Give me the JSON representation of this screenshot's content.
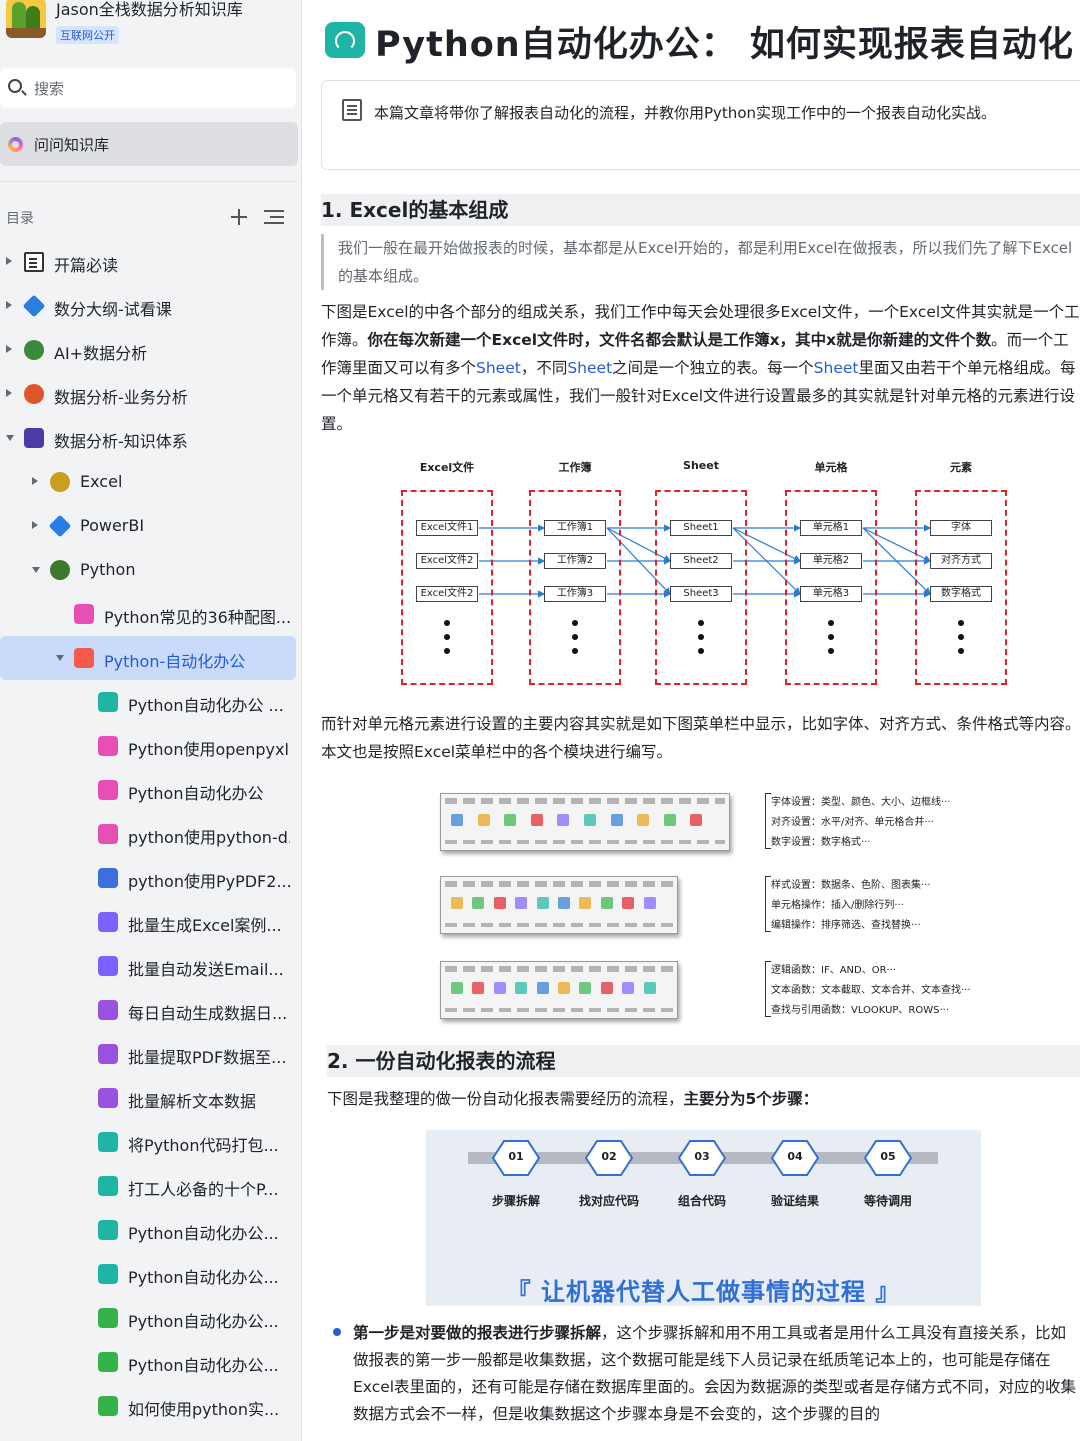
{
  "sidebar": {
    "kb_title": "Jason全栈数据分析知识库",
    "kb_badge": "互联网公开",
    "search_label": "搜索",
    "ask_label": "问问知识库",
    "toc_label": "目录",
    "items": [
      {
        "label": "开篇必读",
        "level": 0,
        "caret": "right",
        "icon": "notepad-icon",
        "color": "#333333"
      },
      {
        "label": "数分大纲-试看课",
        "level": 0,
        "caret": "right",
        "icon": "diamond-icon",
        "color": "#2a7de1"
      },
      {
        "label": "AI+数据分析",
        "level": 0,
        "caret": "right",
        "icon": "ufo-icon",
        "color": "#3a8a3a"
      },
      {
        "label": "数据分析-业务分析",
        "level": 0,
        "caret": "right",
        "icon": "medal-icon",
        "color": "#e0562b"
      },
      {
        "label": "数据分析-知识体系",
        "level": 0,
        "caret": "down",
        "icon": "music-icon",
        "color": "#4b3ba8"
      },
      {
        "label": "Excel",
        "level": 1,
        "caret": "right",
        "icon": "leaf-icon",
        "color": "#c8a01e"
      },
      {
        "label": "PowerBI",
        "level": 1,
        "caret": "right",
        "icon": "diamond-icon",
        "color": "#2a7de1"
      },
      {
        "label": "Python",
        "level": 1,
        "caret": "down",
        "icon": "snake-icon",
        "color": "#3b7a2a"
      },
      {
        "label": "Python常见的36种配图...",
        "level": 2,
        "caret": "",
        "icon": "board-icon",
        "color": "#e84fb4"
      },
      {
        "label": "Python-自动化办公",
        "level": 2,
        "caret": "down",
        "icon": "board-icon",
        "color": "#f25a4c"
      },
      {
        "label": "Python自动化办公 ...",
        "level": 3,
        "caret": "",
        "icon": "board-icon",
        "color": "#1fb5a5"
      },
      {
        "label": "Python使用openpyxl...",
        "level": 3,
        "caret": "",
        "icon": "board-icon",
        "color": "#e84fb4"
      },
      {
        "label": "Python自动化办公",
        "level": 3,
        "caret": "",
        "icon": "board-icon",
        "color": "#e84fb4"
      },
      {
        "label": "python使用python-d...",
        "level": 3,
        "caret": "",
        "icon": "board-icon",
        "color": "#e84fb4"
      },
      {
        "label": "python使用PyPDF2...",
        "level": 3,
        "caret": "",
        "icon": "board-icon",
        "color": "#3b6fe0"
      },
      {
        "label": "批量生成Excel案例...",
        "level": 3,
        "caret": "",
        "icon": "board-icon",
        "color": "#7b61ff"
      },
      {
        "label": "批量自动发送Email...",
        "level": 3,
        "caret": "",
        "icon": "board-icon",
        "color": "#7b61ff"
      },
      {
        "label": "每日自动生成数据日...",
        "level": 3,
        "caret": "",
        "icon": "board-icon",
        "color": "#9b51e0"
      },
      {
        "label": "批量提取PDF数据至...",
        "level": 3,
        "caret": "",
        "icon": "board-icon",
        "color": "#9b51e0"
      },
      {
        "label": "批量解析文本数据",
        "level": 3,
        "caret": "",
        "icon": "board-icon",
        "color": "#9b51e0"
      },
      {
        "label": "将Python代码打包...",
        "level": 3,
        "caret": "",
        "icon": "board-icon",
        "color": "#1fb5a5"
      },
      {
        "label": "打工人必备的十个P...",
        "level": 3,
        "caret": "",
        "icon": "board-icon",
        "color": "#1fb5a5"
      },
      {
        "label": "Python自动化办公...",
        "level": 3,
        "caret": "",
        "icon": "board-icon",
        "color": "#1fb5a5"
      },
      {
        "label": "Python自动化办公...",
        "level": 3,
        "caret": "",
        "icon": "board-icon",
        "color": "#1fb5a5"
      },
      {
        "label": "Python自动化办公...",
        "level": 3,
        "caret": "",
        "icon": "board-icon",
        "color": "#35b34a"
      },
      {
        "label": "Python自动化办公...",
        "level": 3,
        "caret": "",
        "icon": "board-icon",
        "color": "#35b34a"
      },
      {
        "label": "如何使用python实...",
        "level": 3,
        "caret": "",
        "icon": "board-icon",
        "color": "#35b34a"
      }
    ],
    "active_index": 9
  },
  "doc": {
    "title": "Python自动化办公： 如何实现报表自动化",
    "callout": "本篇文章将带你了解报表自动化的流程，并教你用Python实现工作中的一个报表自动化实战。",
    "h1": "1. Excel的基本组成",
    "quote": "我们一般在最开始做报表的时候，基本都是从Excel开始的，都是利用Excel在做报表，所以我们先了解下Excel的基本组成。",
    "para1_a": "下图是Excel的中各个部分的组成关系，我们工作中每天会处理很多Excel文件，一个Excel文件其实就是一个工作簿。",
    "para1_b": "你在每次新建一个Excel文件时，文件名都会默认是工作簿x，其中x就是你新建的文件个数",
    "para1_c": "。而一个工作簿里面又可以有多个",
    "para1_link": "Sheet",
    "para1_d": "，不同",
    "para1_e": "之间是一个独立的表。每一个",
    "para1_f": "里面又由若干个单元格组成。每一个单元格又有若干的元素或属性，我们一般针对Excel文件进行设置最多的其实就是针对单元格的元素进行设置。",
    "para2": "而针对单元格元素进行设置的主要内容其实就是如下图菜单栏中显示，比如字体、对齐方式、条件格式等内容。本文也是按照Excel菜单栏中的各个模块进行编写。",
    "h2": "2. 一份自动化报表的流程",
    "para3_a": "下图是我整理的做一份自动化报表需要经历的流程，",
    "para3_b": "主要分为5个步骤：",
    "bullet_b": "第一步是对要做的报表进行步骤拆解",
    "bullet_rest": "，这个步骤拆解和用不用工具或者是用什么工具没有直接关系，比如做报表的第一步一般都是收集数据，这个数据可能是线下人员记录在纸质笔记本上的，也可能是存储在Excel表里面的，还有可能是存储在数据库里面的。会因为数据源的类型或者是存储方式不同，对应的收集数据方式会不一样，但是收集数据这个步骤本身是不会变的，这个步骤的目的"
  },
  "diagram": {
    "columns": [
      {
        "header": "Excel文件",
        "cells": [
          "Excel文件1",
          "Excel文件2",
          "Excel文件2"
        ]
      },
      {
        "header": "工作簿",
        "cells": [
          "工作簿1",
          "工作簿2",
          "工作簿3"
        ]
      },
      {
        "header": "Sheet",
        "cells": [
          "Sheet1",
          "Sheet2",
          "Sheet3"
        ]
      },
      {
        "header": "单元格",
        "cells": [
          "单元格1",
          "单元格2",
          "单元格3"
        ]
      },
      {
        "header": "元素",
        "cells": [
          "字体",
          "对齐方式",
          "数字格式"
        ]
      }
    ],
    "box_color": "#e0242b",
    "arrow_color": "#2b7bd6"
  },
  "ribbons": {
    "notes": [
      [
        "字体设置：类型、颜色、大小、边框线···",
        "对齐设置：水平/对齐、单元格合并···",
        "数字设置：数字格式···"
      ],
      [
        "样式设置：数据条、色阶、图表集···",
        "单元格操作：插入/删除行列···",
        "编辑操作：排序筛选、查找替换···"
      ],
      [
        "逻辑函数：IF、AND、OR···",
        "文本函数：文本截取、文本合并、文本查找···",
        "查找与引用函数：VLOOKUP、ROWS···"
      ]
    ]
  },
  "process": {
    "steps": [
      {
        "num": "01",
        "label": "步骤拆解"
      },
      {
        "num": "02",
        "label": "找对应代码"
      },
      {
        "num": "03",
        "label": "组合代码"
      },
      {
        "num": "04",
        "label": "验证结果"
      },
      {
        "num": "05",
        "label": "等待调用"
      }
    ],
    "slogan": "『 让机器代替人工做事情的过程 』",
    "hex_color": "#2f6fd6"
  }
}
